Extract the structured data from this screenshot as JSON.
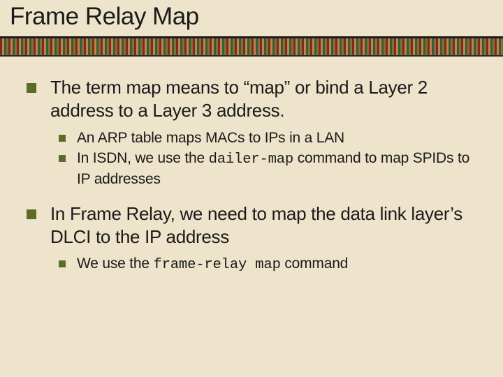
{
  "title": "Frame Relay Map",
  "points": [
    {
      "text": "The term map means to “map” or bind a Layer 2 address to a Layer 3 address.",
      "sub": [
        {
          "text": "An ARP table maps MACs to IPs in a LAN"
        },
        {
          "pre": "In ISDN, we use the ",
          "code": "dailer-map",
          "post": " command to map SPIDs to IP addresses"
        }
      ]
    },
    {
      "text": "In Frame Relay, we need to map the data link layer’s DLCI to the IP address",
      "sub": [
        {
          "pre": "We use the ",
          "code": "frame-relay map",
          "post": " command"
        }
      ]
    }
  ]
}
